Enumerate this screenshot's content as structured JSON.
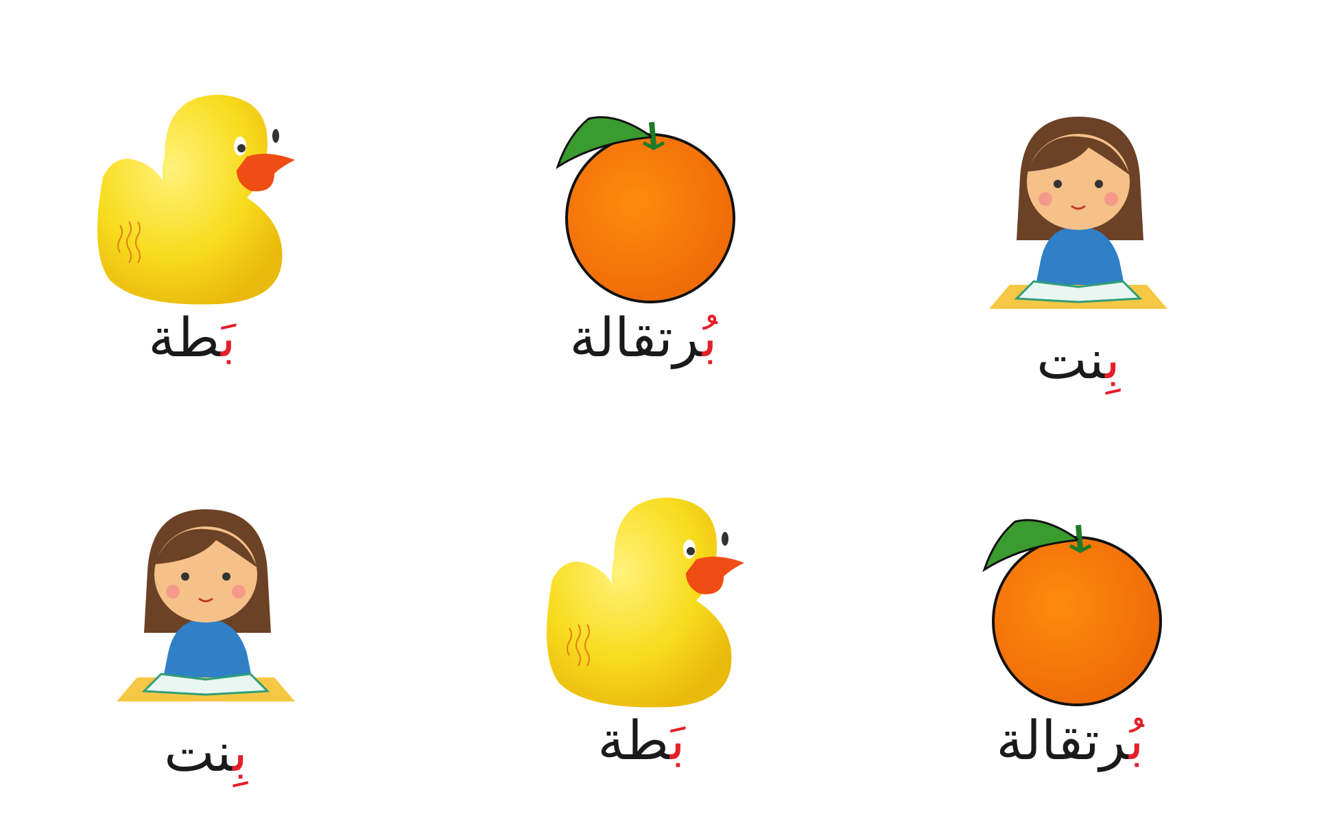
{
  "cards": [
    {
      "picture": "duck",
      "word_first": "بَ‍",
      "word_rest": "‍طة"
    },
    {
      "picture": "orange",
      "word_first": "بُ",
      "word_rest": "رتقالة"
    },
    {
      "picture": "girl-reading",
      "word_first": "بِ‍",
      "word_rest": "‍نت"
    },
    {
      "picture": "girl-reading",
      "word_first": "بِ‍",
      "word_rest": "‍نت"
    },
    {
      "picture": "duck",
      "word_first": "بَ‍",
      "word_rest": "‍طة"
    },
    {
      "picture": "orange",
      "word_first": "بُ",
      "word_rest": "رتقالة"
    }
  ],
  "colors": {
    "highlight": "#e3202a",
    "text": "#1a1a1a"
  }
}
